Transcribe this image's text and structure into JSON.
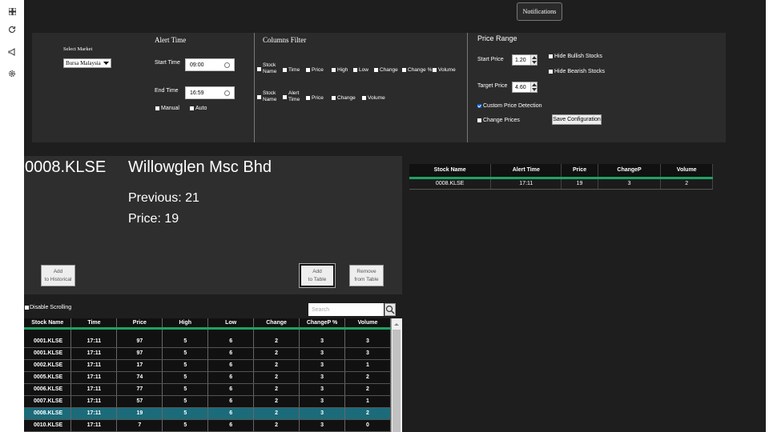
{
  "sidebar": {
    "icons": [
      "grid-icon",
      "refresh-icon",
      "megaphone-icon",
      "settings-icon"
    ]
  },
  "notifications_label": "Notifications",
  "config": {
    "market": {
      "label": "Select Market",
      "value": "Bursa Malaysia"
    },
    "alert_time": {
      "title": "Alert Time",
      "start_label": "Start Time",
      "start_value": "09:00",
      "end_label": "End Time",
      "end_value": "16:59",
      "manual_label": "Manual",
      "auto_label": "Auto"
    },
    "columns_filter": {
      "title": "Columns Filter",
      "row1": {
        "stock_name": "Stock Name",
        "time": "Time",
        "price": "Price",
        "high": "High",
        "low": "Low",
        "change": "Change",
        "change_pct": "Change %",
        "volume": "Volume"
      },
      "row2": {
        "stock_name": "Stock Name",
        "alert_time": "Alert Time",
        "price": "Price",
        "change": "Change",
        "volume": "Volume"
      }
    },
    "price_range": {
      "title": "Price Range",
      "start_label": "Start Price",
      "start_value": "1.20",
      "target_label": "Target Price",
      "target_value": "4.60",
      "hide_bullish": "Hide Bullish Stocks",
      "hide_bearish": "Hide Bearish Stocks",
      "custom_detection": "Custom Price Detection",
      "custom_detection_checked": true,
      "change_prices": "Change Prices",
      "save_label": "Save Configuration"
    }
  },
  "detail": {
    "code": "0008.KLSE",
    "name": "Willowglen Msc Bhd",
    "previous": "Previous: 21",
    "price": "Price: 19",
    "btn_historical_1": "Add",
    "btn_historical_2": "to Historical",
    "btn_table_1": "Add",
    "btn_table_2": "to Table",
    "btn_remove_1": "Remove",
    "btn_remove_2": "from Table"
  },
  "alert_table": {
    "headers": [
      "Stock Name",
      "Alert Time",
      "Price",
      "ChangeP",
      "Volume"
    ],
    "rows": [
      [
        "0008.KLSE",
        "17:11",
        "19",
        "3",
        "2"
      ]
    ]
  },
  "stock_table": {
    "disable_scrolling": "Disable Scrolling",
    "search_placeholder": "Search",
    "headers": [
      "Stock Name",
      "Time",
      "Price",
      "High",
      "Low",
      "Change",
      "ChangeP %",
      "Volume"
    ],
    "rows": [
      [
        "0001.KLSE",
        "17:11",
        "97",
        "5",
        "6",
        "2",
        "3",
        "3"
      ],
      [
        "0001.KLSE",
        "17:11",
        "97",
        "5",
        "6",
        "2",
        "3",
        "3"
      ],
      [
        "0002.KLSE",
        "17:11",
        "17",
        "5",
        "6",
        "2",
        "3",
        "1"
      ],
      [
        "0005.KLSE",
        "17:11",
        "74",
        "5",
        "6",
        "2",
        "3",
        "2"
      ],
      [
        "0006.KLSE",
        "17:11",
        "77",
        "5",
        "6",
        "2",
        "3",
        "2"
      ],
      [
        "0007.KLSE",
        "17:11",
        "57",
        "5",
        "6",
        "2",
        "3",
        "1"
      ],
      [
        "0008.KLSE",
        "17:11",
        "19",
        "5",
        "6",
        "2",
        "3",
        "2"
      ],
      [
        "0010.KLSE",
        "17:11",
        "7",
        "5",
        "6",
        "2",
        "3",
        "0"
      ]
    ],
    "highlight_index": 6
  }
}
